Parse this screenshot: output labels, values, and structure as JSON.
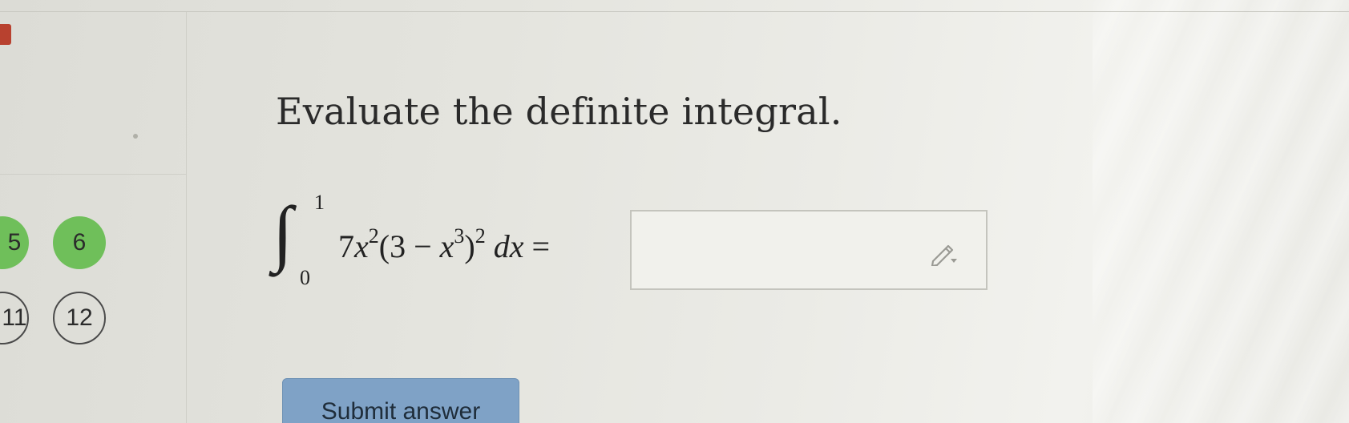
{
  "sidebar": {
    "questions": [
      {
        "label": "5",
        "status": "done"
      },
      {
        "label": "6",
        "status": "done"
      },
      {
        "label": "11",
        "status": "open"
      },
      {
        "label": "12",
        "status": "open"
      }
    ]
  },
  "main": {
    "prompt": "Evaluate the definite integral.",
    "integral": {
      "upper_limit": "1",
      "lower_limit": "0",
      "coefficient": "7",
      "var": "x",
      "exp1": "2",
      "paren_open": "(3 − ",
      "exp2": "3",
      "paren_close": ")",
      "exp3": "2",
      "differential": "dx",
      "equals": "="
    },
    "answer": {
      "value": "",
      "icon": "pencil-dropdown-icon"
    },
    "submit_label": "Submit answer"
  },
  "colors": {
    "done_bubble": "#6fbf5a",
    "submit_bg": "#7fa2c6",
    "marker": "#b8412f"
  }
}
